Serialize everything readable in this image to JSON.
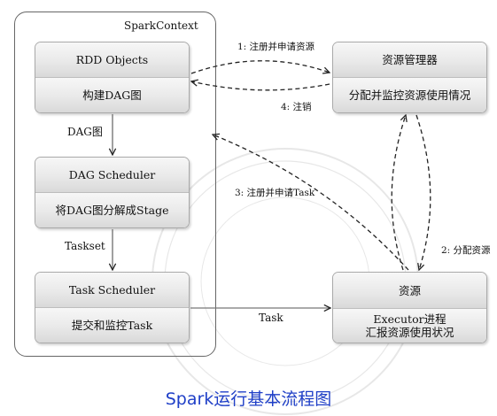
{
  "context": {
    "title": "SparkContext"
  },
  "rdd": {
    "title": "RDD Objects",
    "desc": "构建DAG图"
  },
  "dag_scheduler": {
    "title": "DAG Scheduler",
    "desc": "将DAG图分解成Stage"
  },
  "task_scheduler": {
    "title": "Task Scheduler",
    "desc": "提交和监控Task"
  },
  "resource_manager": {
    "title": "资源管理器",
    "desc": "分配并监控资源使用情况"
  },
  "resource": {
    "title": "资源",
    "desc_line1": "Executor进程",
    "desc_line2": "汇报资源使用状况"
  },
  "edges": {
    "dag": "DAG图",
    "taskset": "Taskset",
    "task": "Task",
    "register_resource": "1: 注册并申请资源",
    "cancel": "4: 注销",
    "register_task": "3: 注册并申请Task",
    "allocate": "2: 分配资源"
  },
  "caption": "Spark运行基本流程图",
  "watermark": "BEIJING JIAOTONG"
}
